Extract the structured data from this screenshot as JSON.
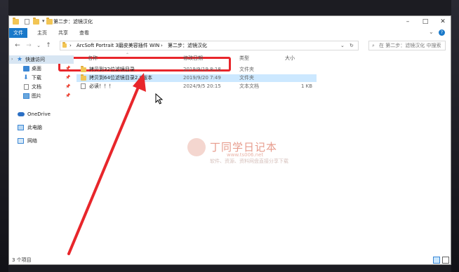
{
  "window": {
    "title": "第二步：滤镜汉化"
  },
  "ribbon": {
    "tabs": [
      "文件",
      "主页",
      "共享",
      "查看"
    ]
  },
  "nav": {
    "back": "←",
    "forward": "→",
    "recent": "⌄",
    "up": "↑"
  },
  "address": {
    "segments": [
      "ArcSoft Portrait 3磨皮美容插件 WIN",
      "第二步：滤镜汉化"
    ],
    "separator": "›",
    "dropdown": "⌄",
    "refresh": "↻"
  },
  "search": {
    "placeholder": "在 第二步：滤镜汉化 中搜索"
  },
  "sidebar": {
    "quick_access": "快速访问",
    "items": [
      {
        "label": "桌面",
        "icon": "desktop-icon"
      },
      {
        "label": "下载",
        "icon": "download-icon"
      },
      {
        "label": "文档",
        "icon": "document-icon"
      },
      {
        "label": "图片",
        "icon": "picture-icon"
      }
    ],
    "onedrive": "OneDrive",
    "this_pc": "此电脑",
    "network": "网络"
  },
  "columns": [
    "名称",
    "修改日期",
    "类型",
    "大小"
  ],
  "files": [
    {
      "name": "拷贝到32位滤镜目录",
      "date": "2019/9/19 8:18",
      "type": "文件夹",
      "size": "",
      "icon": "folder-icon"
    },
    {
      "name": "拷贝到64位滤镜目录2.0版本",
      "date": "2019/9/20 7:49",
      "type": "文件夹",
      "size": "",
      "icon": "folder-icon"
    },
    {
      "name": "必读！！！",
      "date": "2024/9/5 20:15",
      "type": "文本文档",
      "size": "1 KB",
      "icon": "text-file-icon"
    }
  ],
  "status": {
    "count": "3 个项目"
  },
  "watermark": {
    "title": "丁同学日记本",
    "url": "www.ts006.net",
    "subtitle": "软件、资源、资料网盘直接分享下载"
  },
  "colors": {
    "annotation": "#e8262b",
    "file_tab": "#1979ca",
    "selection": "#cce8ff",
    "folder": "#f2c554"
  }
}
